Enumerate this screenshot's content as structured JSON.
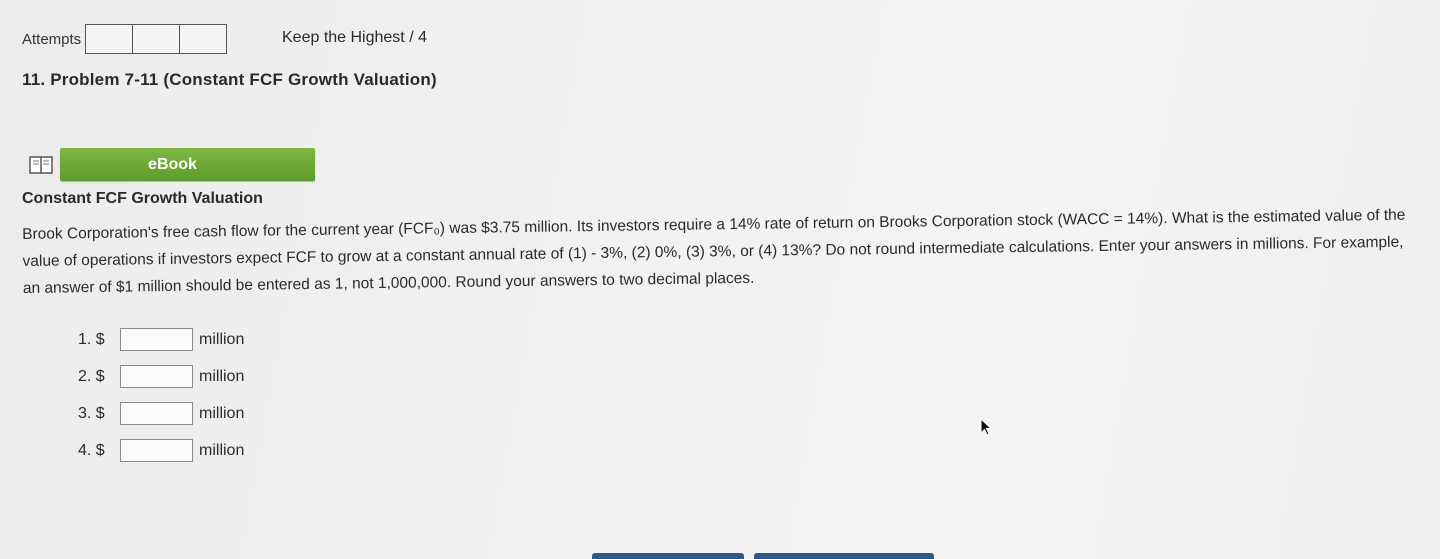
{
  "header": {
    "attempts_label": "Attempts",
    "keep_highest": "Keep the Highest / 4"
  },
  "problem": {
    "title": "11. Problem 7-11 (Constant FCF Growth Valuation)"
  },
  "ebook": {
    "button_label": "eBook",
    "icon": "book-icon"
  },
  "section": {
    "title": "Constant FCF Growth Valuation",
    "body": "Brook Corporation's free cash flow for the current year (FCF₀) was $3.75 million. Its investors require a 14% rate of return on Brooks Corporation stock (WACC = 14%). What is the estimated value of the value of operations if investors expect FCF to grow at a constant annual rate of (1) - 3%, (2) 0%, (3) 3%, or (4) 13%? Do not round intermediate calculations. Enter your answers in millions. For example, an answer of $1 million should be entered as 1, not 1,000,000. Round your answers to two decimal places."
  },
  "answers": [
    {
      "label": "1. $",
      "value": "",
      "unit": "million"
    },
    {
      "label": "2. $",
      "value": "",
      "unit": "million"
    },
    {
      "label": "3. $",
      "value": "",
      "unit": "million"
    },
    {
      "label": "4. $",
      "value": "",
      "unit": "million"
    }
  ],
  "colors": {
    "ebook_green": "#6aa833",
    "footer_button_blue": "#2a5a8c"
  }
}
